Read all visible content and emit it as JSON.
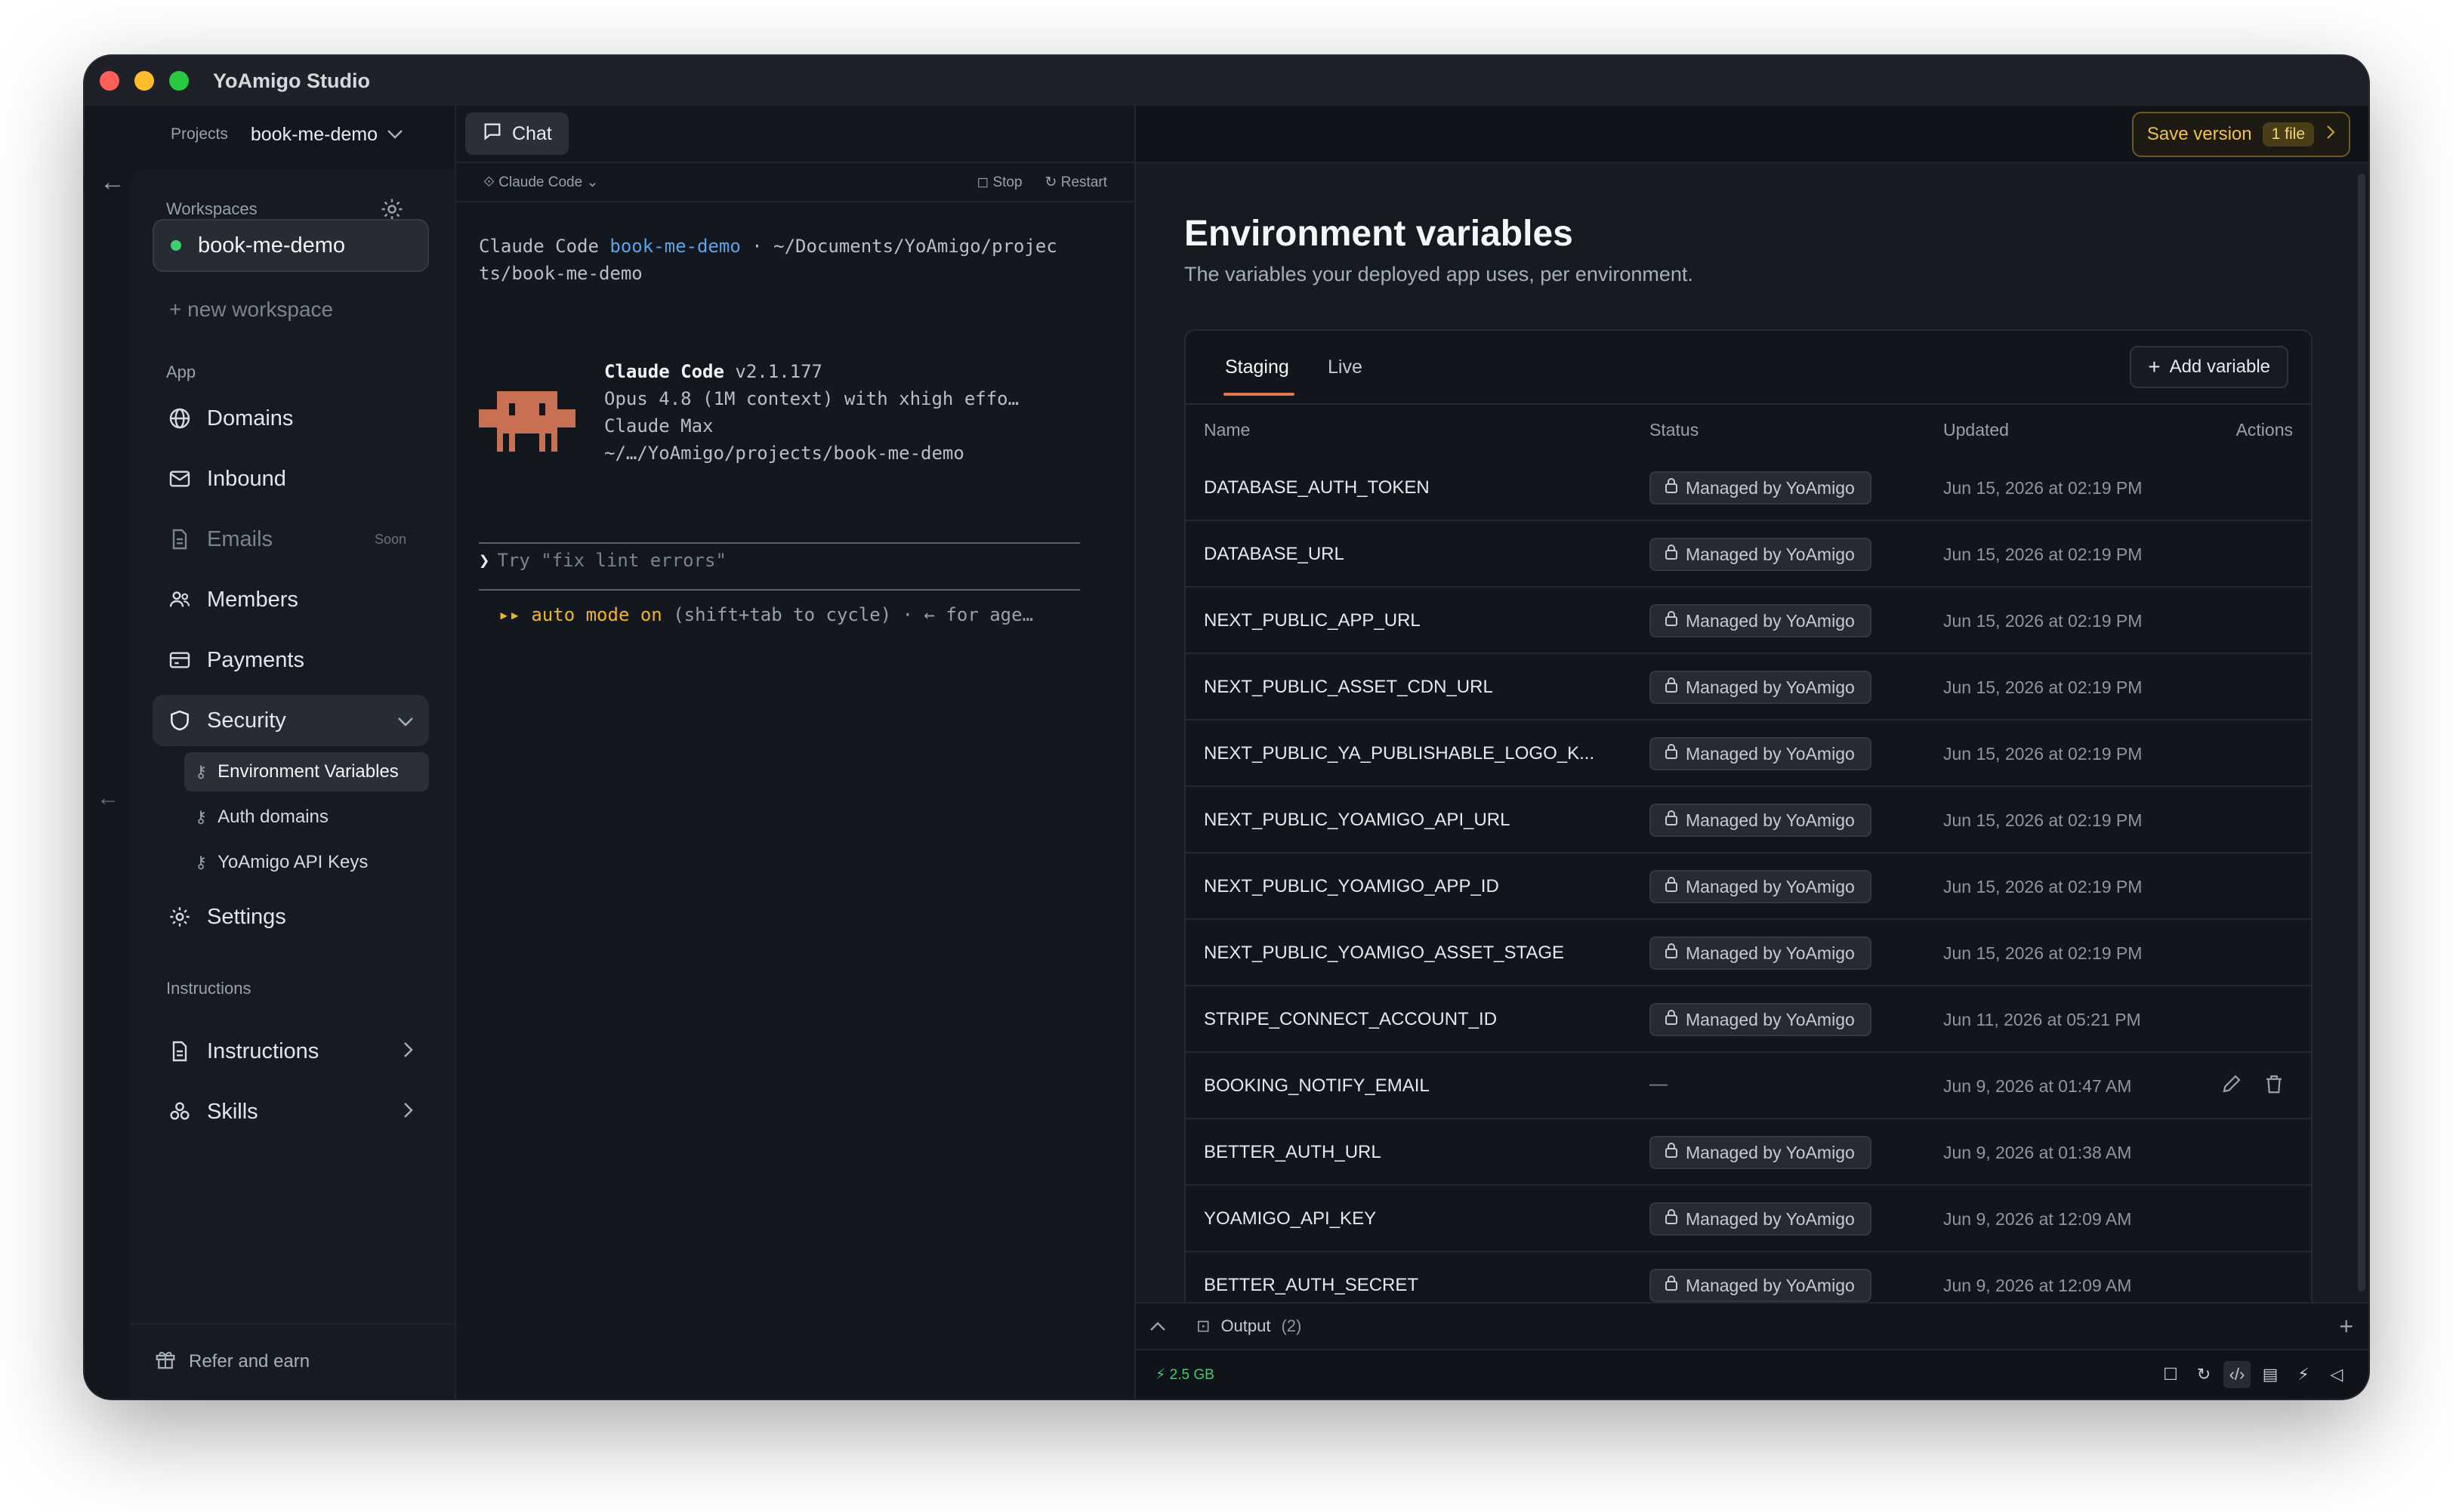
{
  "window": {
    "title": "YoAmigo Studio"
  },
  "project_bar": {
    "label": "Projects",
    "project": "book-me-demo"
  },
  "sidebar": {
    "workspaces_heading": "Workspaces",
    "workspace": "book-me-demo",
    "new_workspace": "+ new workspace",
    "app_heading": "App",
    "items": [
      {
        "label": "Domains",
        "icon": "globe-icon"
      },
      {
        "label": "Inbound",
        "icon": "mail-icon"
      },
      {
        "label": "Emails",
        "icon": "document-icon",
        "badge": "Soon"
      },
      {
        "label": "Members",
        "icon": "users-icon"
      },
      {
        "label": "Payments",
        "icon": "card-icon"
      },
      {
        "label": "Security",
        "icon": "shield-icon"
      }
    ],
    "security_sub": [
      "Environment Variables",
      "Auth domains",
      "YoAmigo API Keys"
    ],
    "settings": "Settings",
    "instructions_heading": "Instructions",
    "instructions": "Instructions",
    "skills": "Skills",
    "footer": "Refer and earn"
  },
  "chat": {
    "tab": "Chat",
    "agent": "Claude Code",
    "stop": "Stop",
    "restart": "Restart",
    "path_prefix": "Claude Code ",
    "path_project": "book-me-demo",
    "path_rest": " · ~/Documents/YoAmigo/projec",
    "path_line2": "ts/book-me-demo",
    "info_title": "Claude Code",
    "info_version": " v2.1.177",
    "info_model": "Opus 4.8 (1M context) with xhigh effo…",
    "info_plan": "Claude Max",
    "info_dir": "~/…/YoAmigo/projects/book-me-demo",
    "prompt_caret": "❯",
    "prompt_hint": "Try \"fix lint errors\"",
    "auto_prefix": "▸▸ auto mode on",
    "auto_rest": " (shift+tab to cycle) · ← for age…"
  },
  "topbar": {
    "save_label": "Save version",
    "save_badge": "1 file"
  },
  "page": {
    "title": "Environment variables",
    "subtitle": "The variables your deployed app uses, per environment."
  },
  "tabs": [
    "Staging",
    "Live"
  ],
  "add_variable": "Add variable",
  "table": {
    "columns": [
      "Name",
      "Status",
      "Updated",
      "Actions"
    ],
    "rows": [
      {
        "name": "DATABASE_AUTH_TOKEN",
        "status": "Managed by YoAmigo",
        "updated": "Jun 15, 2026 at 02:19 PM"
      },
      {
        "name": "DATABASE_URL",
        "status": "Managed by YoAmigo",
        "updated": "Jun 15, 2026 at 02:19 PM"
      },
      {
        "name": "NEXT_PUBLIC_APP_URL",
        "status": "Managed by YoAmigo",
        "updated": "Jun 15, 2026 at 02:19 PM"
      },
      {
        "name": "NEXT_PUBLIC_ASSET_CDN_URL",
        "status": "Managed by YoAmigo",
        "updated": "Jun 15, 2026 at 02:19 PM"
      },
      {
        "name": "NEXT_PUBLIC_YA_PUBLISHABLE_LOGO_K...",
        "status": "Managed by YoAmigo",
        "updated": "Jun 15, 2026 at 02:19 PM"
      },
      {
        "name": "NEXT_PUBLIC_YOAMIGO_API_URL",
        "status": "Managed by YoAmigo",
        "updated": "Jun 15, 2026 at 02:19 PM"
      },
      {
        "name": "NEXT_PUBLIC_YOAMIGO_APP_ID",
        "status": "Managed by YoAmigo",
        "updated": "Jun 15, 2026 at 02:19 PM"
      },
      {
        "name": "NEXT_PUBLIC_YOAMIGO_ASSET_STAGE",
        "status": "Managed by YoAmigo",
        "updated": "Jun 15, 2026 at 02:19 PM"
      },
      {
        "name": "STRIPE_CONNECT_ACCOUNT_ID",
        "status": "Managed by YoAmigo",
        "updated": "Jun 11, 2026 at 05:21 PM"
      },
      {
        "name": "BOOKING_NOTIFY_EMAIL",
        "status": "—",
        "updated": "Jun 9, 2026 at 01:47 AM",
        "editable": true
      },
      {
        "name": "BETTER_AUTH_URL",
        "status": "Managed by YoAmigo",
        "updated": "Jun 9, 2026 at 01:38 AM"
      },
      {
        "name": "YOAMIGO_API_KEY",
        "status": "Managed by YoAmigo",
        "updated": "Jun 9, 2026 at 12:09 AM"
      },
      {
        "name": "BETTER_AUTH_SECRET",
        "status": "Managed by YoAmigo",
        "updated": "Jun 9, 2026 at 12:09 AM"
      }
    ]
  },
  "output": {
    "label": "Output",
    "count": "(2)"
  },
  "status": {
    "memory": "2.5 GB"
  },
  "colors": {
    "accent": "#e07a4a",
    "save": "#f0c24a",
    "online": "#3ecf6e"
  }
}
